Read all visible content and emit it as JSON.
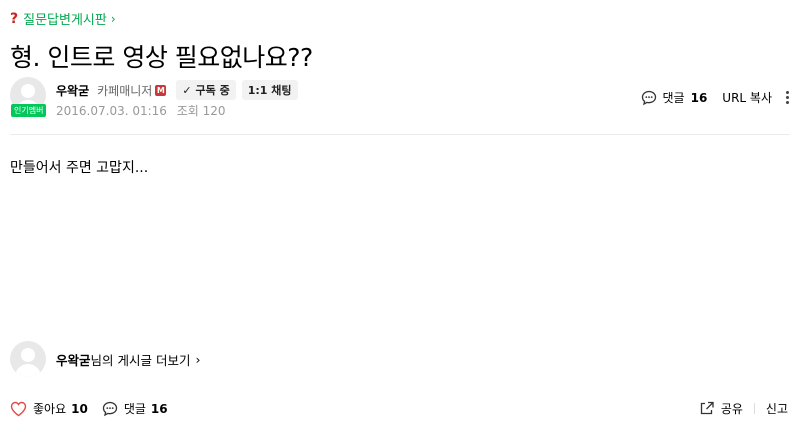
{
  "board": {
    "name": "질문답변게시판",
    "icon": "question-mark-icon"
  },
  "post": {
    "title": "형. 인트로 영상 필요없나요??",
    "content": "만들어서 주면 고맙지..."
  },
  "author": {
    "name": "우왁굳",
    "role": "카페매니저",
    "manager_mark": "M",
    "member_badge": "인기멤버",
    "subscribe_label": "구독 중",
    "chat_label": "1:1 채팅"
  },
  "meta": {
    "date": "2016.07.03. 01:16",
    "views_label": "조회 120"
  },
  "actions": {
    "comment_label": "댓글",
    "comment_count": "16",
    "url_copy_label": "URL 복사"
  },
  "more_posts": {
    "name": "우왁굳",
    "suffix": "님의 게시글 더보기"
  },
  "footer": {
    "like_label": "좋아요",
    "like_count": "10",
    "comment_label": "댓글",
    "comment_count": "16",
    "share_label": "공유",
    "report_label": "신고"
  },
  "colors": {
    "accent": "#03a94e",
    "badge": "#03c75a",
    "manager": "#c73a3a",
    "like": "#e14b4b"
  }
}
